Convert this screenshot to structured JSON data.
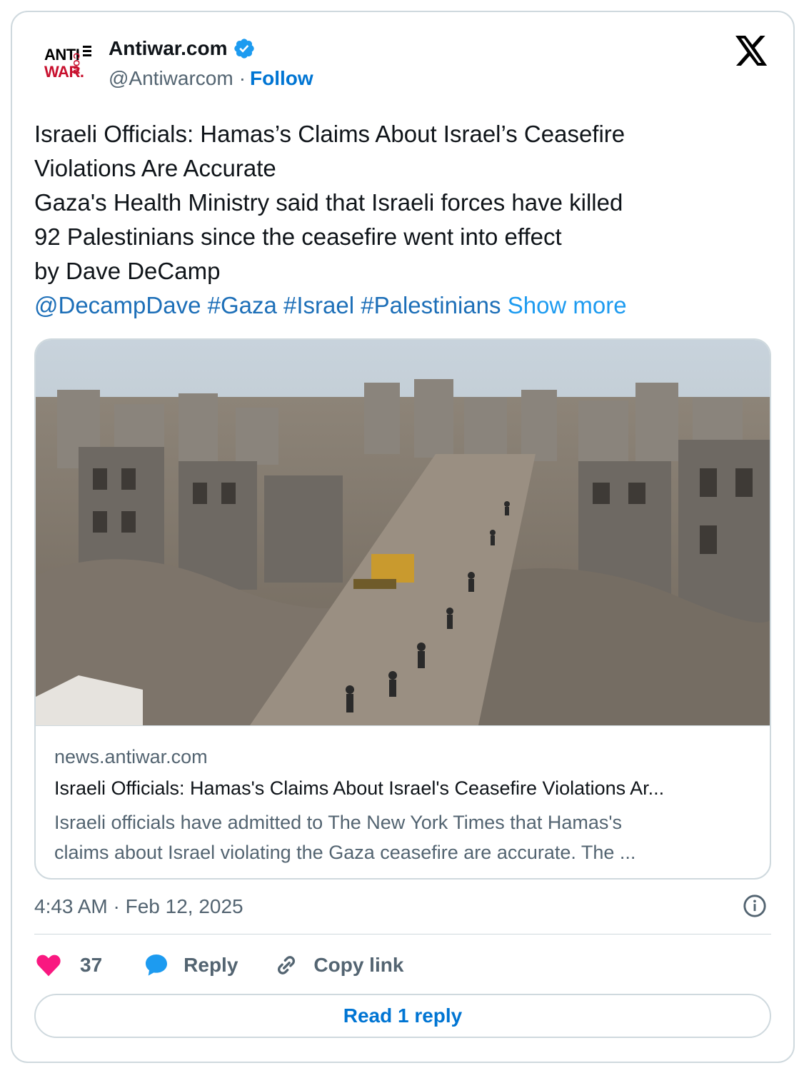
{
  "colors": {
    "accent": "#0075d3",
    "link": "#1d9bf0",
    "like": "#f91880",
    "muted": "#536471",
    "border": "#cfd9de"
  },
  "author": {
    "avatar_line1": "ANTI",
    "avatar_line2": "WAR.",
    "avatar_side": "COM",
    "name": "Antiwar.com",
    "verified_icon": "verified-badge-icon",
    "handle": "@Antiwarcom",
    "separator": "·",
    "follow_label": "Follow"
  },
  "platform_icon": "x-logo-icon",
  "tweet": {
    "lines": [
      "Israeli Officials: Hamas’s Claims About Israel’s Ceasefire",
      "Violations Are Accurate",
      "Gaza's Health Ministry said that Israeli forces have killed",
      "92 Palestinians since the ceasefire went into effect",
      "by Dave DeCamp"
    ],
    "mention": "@DecampDave",
    "hashtags": [
      "#Gaza",
      "#Israel",
      "#Palestinians"
    ],
    "show_more": "Show more"
  },
  "link_card": {
    "image_icon": "destroyed-city-photo",
    "domain": "news.antiwar.com",
    "title": "Israeli Officials: Hamas's Claims About Israel's Ceasefire Violations Ar...",
    "description_lines": [
      "Israeli officials have admitted to The New York Times that Hamas's",
      "claims about Israel violating the Gaza ceasefire are accurate. The ..."
    ]
  },
  "timestamp": "4:43 AM · Feb 12, 2025",
  "actions": {
    "like_count": "37",
    "reply_label": "Reply",
    "copy_label": "Copy link"
  },
  "read_reply_label": "Read 1 reply"
}
